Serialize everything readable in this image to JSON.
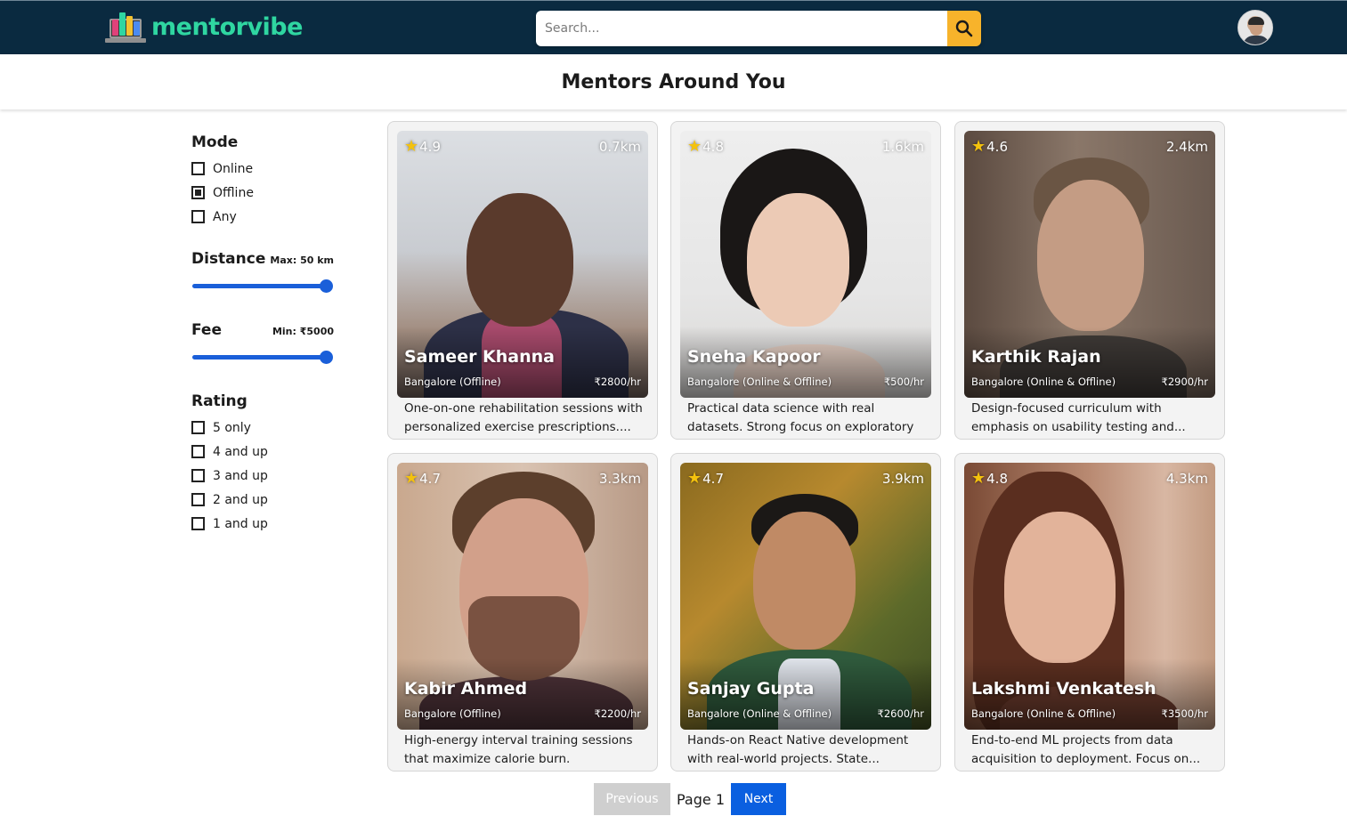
{
  "header": {
    "logo_text": "mentorvibe",
    "search_placeholder": "Search...",
    "search_icon": "search-icon",
    "brand_color": "#2fd6a1",
    "bar_color": "#0a2a40",
    "accent_color": "#f7b32b"
  },
  "page_title": "Mentors Around You",
  "filters": {
    "mode": {
      "heading": "Mode",
      "options": [
        {
          "label": "Online",
          "checked": false
        },
        {
          "label": "Offline",
          "checked": true
        },
        {
          "label": "Any",
          "checked": false
        }
      ]
    },
    "distance": {
      "heading": "Distance",
      "note": "Max: 50 km",
      "value_fraction": 1.0
    },
    "fee": {
      "heading": "Fee",
      "note": "Min: ₹5000",
      "value_fraction": 1.0
    },
    "rating": {
      "heading": "Rating",
      "options": [
        {
          "label": "5 only",
          "checked": false
        },
        {
          "label": "4 and up",
          "checked": false
        },
        {
          "label": "3 and up",
          "checked": false
        },
        {
          "label": "2 and up",
          "checked": false
        },
        {
          "label": "1 and up",
          "checked": false
        }
      ]
    }
  },
  "mentors": [
    {
      "rating": "4.9",
      "distance": "0.7km",
      "name": "Sameer Khanna",
      "location": "Bangalore (Offline)",
      "fee": "₹2800/hr",
      "description": "One-on-one rehabilitation sessions with personalized exercise prescriptions...."
    },
    {
      "rating": "4.8",
      "distance": "1.6km",
      "name": "Sneha Kapoor",
      "location": "Bangalore (Online & Offline)",
      "fee": "₹500/hr",
      "description": "Practical data science with real datasets. Strong focus on exploratory data..."
    },
    {
      "rating": "4.6",
      "distance": "2.4km",
      "name": "Karthik Rajan",
      "location": "Bangalore (Online & Offline)",
      "fee": "₹2900/hr",
      "description": "Design-focused curriculum with emphasis on usability testing and..."
    },
    {
      "rating": "4.7",
      "distance": "3.3km",
      "name": "Kabir Ahmed",
      "location": "Bangalore (Offline)",
      "fee": "₹2200/hr",
      "description": "High-energy interval training sessions that maximize calorie burn. Adaptable..."
    },
    {
      "rating": "4.7",
      "distance": "3.9km",
      "name": "Sanjay Gupta",
      "location": "Bangalore (Online & Offline)",
      "fee": "₹2600/hr",
      "description": "Hands-on React Native development with real-world projects. State..."
    },
    {
      "rating": "4.8",
      "distance": "4.3km",
      "name": "Lakshmi Venkatesh",
      "location": "Bangalore (Online & Offline)",
      "fee": "₹3500/hr",
      "description": "End-to-end ML projects from data acquisition to deployment. Focus on..."
    }
  ],
  "pagination": {
    "previous": "Previous",
    "page_label": "Page 1",
    "next": "Next"
  }
}
